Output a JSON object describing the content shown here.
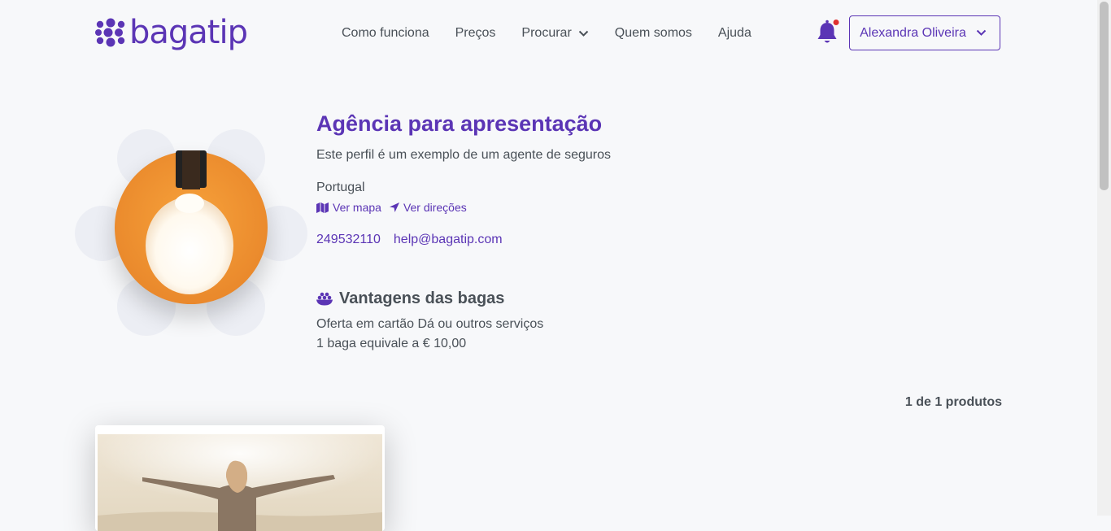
{
  "header": {
    "logo_text": "bagatip",
    "nav": [
      "Como funciona",
      "Preços",
      "Procurar",
      "Quem somos",
      "Ajuda"
    ],
    "user_name": "Alexandra Oliveira",
    "icons": {
      "bell": "bell-icon",
      "notification": "notification-dot",
      "chevron": "chevron-down-icon"
    },
    "colors": {
      "brand": "#5b35b5",
      "notification": "#e03131"
    }
  },
  "profile": {
    "title": "Agência para apresentação",
    "description": "Este perfil é um exemplo de um agente de seguros",
    "country": "Portugal",
    "map_link": "Ver mapa",
    "directions_link": "Ver direções",
    "phone": "249532110",
    "email": "help@bagatip.com",
    "avatar": "light-bulb-photo"
  },
  "perks": {
    "heading": "Vantagens das bagas",
    "line1": "Oferta em cartão Dá ou outros serviços",
    "line2": "1 baga equivale a € 10,00"
  },
  "products": {
    "count_text": "1 de 1 produtos",
    "items": [
      {
        "image": "woman-arms-outstretched-photo"
      }
    ]
  }
}
